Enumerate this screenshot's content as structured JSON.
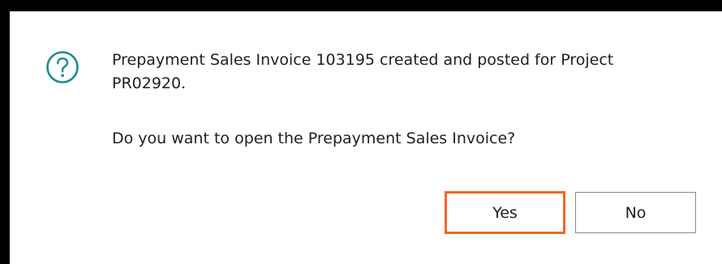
{
  "dialog": {
    "icon": "question-circle-icon",
    "icon_color": "#1a8c8c",
    "message_line1": "Prepayment Sales Invoice 103195 created and posted for Project",
    "message_line2": "PR02920.",
    "question": "Do you want to open the Prepayment Sales Invoice?",
    "yes_label": "Yes",
    "no_label": "No",
    "focus_color": "#f26722"
  }
}
